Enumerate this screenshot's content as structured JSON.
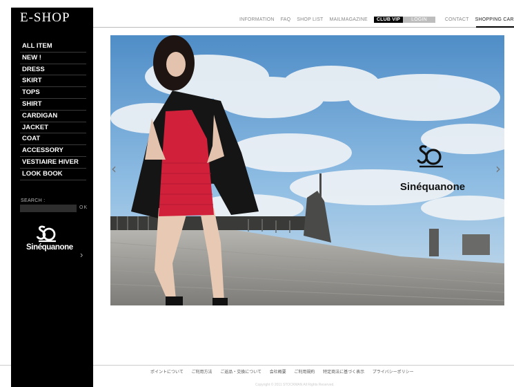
{
  "shop": {
    "logo": "E-SHOP"
  },
  "topnav": {
    "information": "INFORMATION",
    "faq": "FAQ",
    "shop_list": "SHOP LIST",
    "mailmagazine": "MAILMAGAZINE",
    "club_vip": "CLUB VIP",
    "login": "LOGIN",
    "contact": "CONTACT",
    "shopping_cart": "SHOPPING CAR"
  },
  "sidebar": {
    "items": [
      "ALL ITEM",
      "NEW !",
      "DRESS",
      "SKIRT",
      "TOPS",
      "SHIRT",
      "CARDIGAN",
      "JACKET",
      "COAT",
      "ACCESSORY",
      "VESTIAIRE HIVER",
      "LOOK BOOK"
    ],
    "search_label": "SEARCH :",
    "search_value": "",
    "search_button": "OK",
    "brand": "Sinéquanone",
    "next_arrow": "›"
  },
  "hero": {
    "brand": "Sinéquanone",
    "prev_arrow": "‹",
    "next_arrow": "›"
  },
  "footer": {
    "links": [
      "ポイントについて",
      "ご利用方法",
      "ご返品・交換について",
      "会社概要",
      "ご利用規約",
      "特定商法に基づく表示",
      "プライバシーポリシー"
    ],
    "copyright": "Copyright © 2011 STOCKMAN All Rights Reserved."
  },
  "colors": {
    "sidebar_bg": "#000000",
    "dress_red": "#d0203a",
    "sky": "#6fa5d8"
  },
  "icons": {
    "prev": "chevron-left-icon",
    "next": "chevron-right-icon",
    "brand": "sinequanone-logo-icon"
  }
}
